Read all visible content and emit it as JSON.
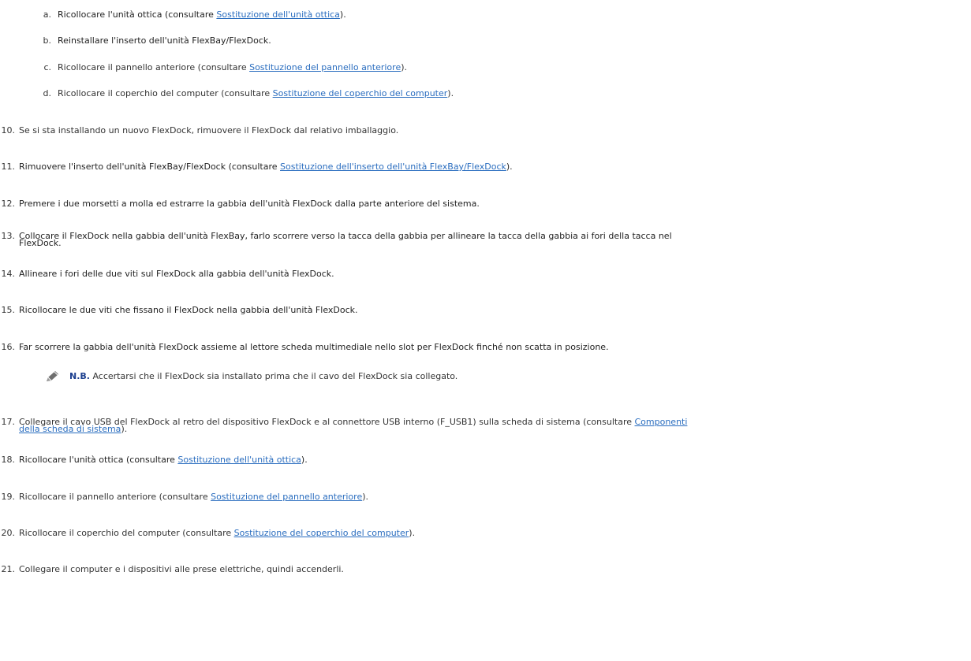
{
  "sub_steps": [
    {
      "marker": "a.",
      "before": "Ricollocare l'unità ottica (consultare ",
      "link": "Sostituzione dell'unità ottica",
      "after": ")."
    },
    {
      "marker": "b.",
      "before": "Reinstallare l'inserto dell'unità FlexBay/FlexDock.",
      "link": "",
      "after": ""
    },
    {
      "marker": "c.",
      "before": "Ricollocare il pannello anteriore (consultare ",
      "link": "Sostituzione del pannello anteriore",
      "after": ")."
    },
    {
      "marker": "d.",
      "before": "Ricollocare il coperchio del computer (consultare ",
      "link": "Sostituzione del coperchio del computer",
      "after": ")."
    }
  ],
  "steps": [
    {
      "number": "10.",
      "before": "Se si sta installando un nuovo FlexDock, rimuovere il FlexDock dal relativo imballaggio.",
      "link": "",
      "after": ""
    },
    {
      "number": "11.",
      "before": "Rimuovere l'inserto dell'unità FlexBay/FlexDock (consultare ",
      "link": "Sostituzione dell'inserto dell'unità FlexBay/FlexDock",
      "after": ")."
    },
    {
      "number": "12.",
      "before": "Premere i due morsetti a molla ed estrarre la gabbia dell'unità FlexDock dalla parte anteriore del sistema.",
      "link": "",
      "after": ""
    },
    {
      "number": "13.",
      "line1": "Collocare il FlexDock nella gabbia dell'unità FlexBay, farlo scorrere verso la tacca della gabbia per allineare la tacca della gabbia ai fori della tacca nel",
      "line2": "FlexDock."
    },
    {
      "number": "14.",
      "before": "Allineare i fori delle due viti sul FlexDock alla gabbia dell'unità FlexDock.",
      "link": "",
      "after": ""
    },
    {
      "number": "15.",
      "before": "Ricollocare le due viti che fissano il FlexDock nella gabbia dell'unità FlexDock.",
      "link": "",
      "after": ""
    },
    {
      "number": "16.",
      "before": "Far scorrere la gabbia dell'unità FlexDock assieme al lettore scheda multimediale nello slot per FlexDock finché non scatta in posizione.",
      "link": "",
      "after": ""
    },
    {
      "number": "17.",
      "line1_before": "Collegare il cavo USB del FlexDock al retro del dispositivo FlexDock e al connettore USB interno (F_USB1) sulla scheda di sistema (consultare ",
      "line1_link": "Componenti",
      "line2_link": "della scheda di sistema",
      "line2_after": ")."
    },
    {
      "number": "18.",
      "before": "Ricollocare l'unità ottica (consultare ",
      "link": "Sostituzione dell'unità ottica",
      "after": ")."
    },
    {
      "number": "19.",
      "before": "Ricollocare il pannello anteriore (consultare ",
      "link": "Sostituzione del pannello anteriore",
      "after": ")."
    },
    {
      "number": "20.",
      "before": "Ricollocare il coperchio del computer (consultare ",
      "link": "Sostituzione del coperchio del computer",
      "after": ")."
    },
    {
      "number": "21.",
      "before": "Collegare il computer e i dispositivi alle prese elettriche, quindi accenderli.",
      "link": "",
      "after": ""
    }
  ],
  "note": {
    "icon": "note-pencil-icon",
    "label": "N.B.",
    "text": " Accertarsi che il FlexDock sia installato prima che il cavo del FlexDock sia collegato."
  }
}
